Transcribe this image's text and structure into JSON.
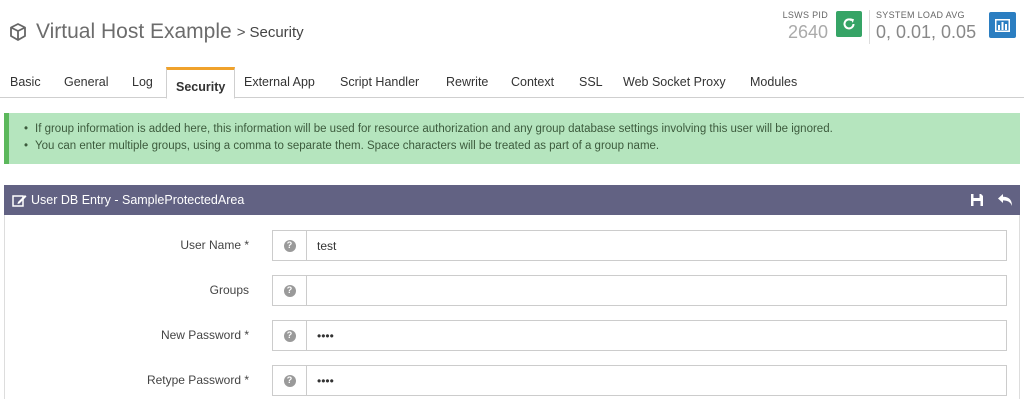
{
  "header": {
    "title": "Virtual Host Example",
    "separator": ">",
    "current_page": "Security",
    "lsws_pid_label": "LSWS PID",
    "lsws_pid_value": "2640",
    "load_label": "SYSTEM LOAD AVG",
    "load_value": "0, 0.01, 0.05"
  },
  "tabs": [
    {
      "label": "Basic"
    },
    {
      "label": "General"
    },
    {
      "label": "Log"
    },
    {
      "label": "Security",
      "active": true
    },
    {
      "label": "External App"
    },
    {
      "label": "Script Handler"
    },
    {
      "label": "Rewrite"
    },
    {
      "label": "Context"
    },
    {
      "label": "SSL"
    },
    {
      "label": "Web Socket Proxy"
    },
    {
      "label": "Modules"
    }
  ],
  "info": {
    "lines": [
      "If group information is added here, this information will be used for resource authorization and any group database settings involving this user will be ignored.",
      "You can enter multiple groups, using a comma to separate them. Space characters will be treated as part of a group name."
    ]
  },
  "panel": {
    "title": "User DB Entry - SampleProtectedArea",
    "fields": [
      {
        "label": "User Name *",
        "value": "test"
      },
      {
        "label": "Groups",
        "value": ""
      },
      {
        "label": "New Password *",
        "value": "••••"
      },
      {
        "label": "Retype Password *",
        "value": "••••"
      }
    ],
    "help_glyph": "?"
  },
  "colors": {
    "accent_tab": "#f0a22b",
    "panel_header": "#626283",
    "info_bg": "#b5e5be",
    "info_border": "#5cb85c",
    "restart_button": "#36a466",
    "stats_button": "#2b7ec1"
  },
  "icons": {
    "title": "cube-icon",
    "restart": "refresh-icon",
    "stats": "bar-chart-icon",
    "panel_edit": "edit-icon",
    "panel_save": "save-icon",
    "panel_back": "undo-icon",
    "field_help": "help-icon"
  }
}
